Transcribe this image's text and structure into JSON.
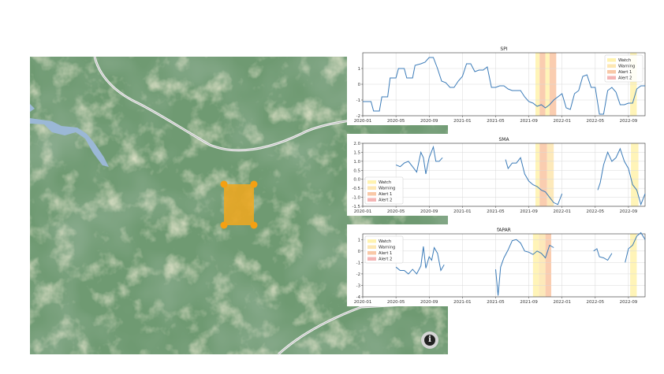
{
  "map": {
    "selection_color": "#f2a81d",
    "handle_color": "#f5a012",
    "info_icon": "info-icon"
  },
  "legend_labels": [
    "Watch",
    "Warning",
    "Alert 1",
    "Alert 2"
  ],
  "legend_colors": [
    "#fff3b0",
    "#fde7b3",
    "#f9c8a7",
    "#f4b5b5"
  ],
  "line_color": "#3b7bb8",
  "chart_data": [
    {
      "type": "line",
      "title": "SPI",
      "legend_position": "top-right",
      "x_ticks": [
        "2020-01",
        "2020-05",
        "2020-09",
        "2021-01",
        "2021-05",
        "2021-09",
        "2022-01",
        "2022-05",
        "2022-09"
      ],
      "x_range": [
        0,
        34
      ],
      "ylim": [
        -2,
        2
      ],
      "y_ticks": [
        "-2",
        "-1",
        "0",
        "1"
      ],
      "bands": [
        {
          "type": "Watch",
          "x": [
            20.8,
            21.3
          ]
        },
        {
          "type": "Alert 1",
          "x": [
            21.3,
            22.0
          ]
        },
        {
          "type": "Watch",
          "x": [
            22.0,
            22.5
          ]
        },
        {
          "type": "Alert 1",
          "x": [
            22.5,
            23.3
          ]
        },
        {
          "type": "Watch",
          "x": [
            32.2,
            33.0
          ]
        }
      ],
      "series": [
        {
          "segments": [
            [
              [
                0,
                -1.1
              ],
              [
                1,
                -1.1
              ],
              [
                1.3,
                -1.7
              ],
              [
                2,
                -1.7
              ],
              [
                2.3,
                -0.8
              ],
              [
                3,
                -0.8
              ],
              [
                3.3,
                0.4
              ],
              [
                4,
                0.4
              ],
              [
                4.3,
                1.0
              ],
              [
                5,
                1.0
              ],
              [
                5.3,
                0.4
              ],
              [
                6,
                0.4
              ],
              [
                6.3,
                1.2
              ],
              [
                7,
                1.3
              ],
              [
                7.5,
                1.4
              ],
              [
                8,
                1.7
              ],
              [
                8.5,
                1.7
              ],
              [
                9,
                1.0
              ],
              [
                9.5,
                0.2
              ],
              [
                10,
                0.1
              ],
              [
                10.5,
                -0.2
              ],
              [
                11,
                -0.2
              ],
              [
                11.5,
                0.2
              ],
              [
                12,
                0.5
              ],
              [
                12.5,
                1.3
              ],
              [
                13,
                1.3
              ],
              [
                13.5,
                0.8
              ],
              [
                14,
                0.9
              ],
              [
                14.5,
                0.9
              ],
              [
                15,
                1.1
              ],
              [
                15.5,
                -0.2
              ],
              [
                16,
                -0.2
              ],
              [
                16.5,
                -0.1
              ],
              [
                17,
                -0.1
              ],
              [
                17.5,
                -0.3
              ],
              [
                18,
                -0.4
              ],
              [
                19,
                -0.4
              ],
              [
                19.5,
                -0.8
              ],
              [
                20,
                -1.1
              ],
              [
                20.5,
                -1.2
              ],
              [
                21,
                -1.4
              ],
              [
                21.5,
                -1.3
              ],
              [
                22,
                -1.5
              ],
              [
                22.5,
                -1.3
              ],
              [
                23,
                -1.0
              ],
              [
                24,
                -0.6
              ],
              [
                24.5,
                -1.5
              ],
              [
                25,
                -1.6
              ],
              [
                25.5,
                -0.6
              ],
              [
                26,
                -0.4
              ],
              [
                26.5,
                0.5
              ],
              [
                27,
                0.6
              ],
              [
                27.5,
                -0.2
              ],
              [
                28,
                -0.2
              ],
              [
                28.5,
                -1.9
              ],
              [
                29,
                -1.9
              ],
              [
                29.5,
                -0.4
              ],
              [
                30,
                -0.2
              ],
              [
                30.5,
                -0.5
              ],
              [
                31,
                -1.3
              ],
              [
                31.5,
                -1.3
              ],
              [
                32,
                -1.2
              ],
              [
                32.5,
                -1.2
              ],
              [
                33,
                -0.3
              ],
              [
                33.5,
                -0.1
              ],
              [
                34,
                -0.1
              ]
            ]
          ]
        }
      ]
    },
    {
      "type": "line",
      "title": "SMA",
      "legend_position": "bottom-left",
      "x_ticks": [
        "2020-01",
        "2020-05",
        "2020-09",
        "2021-01",
        "2021-05",
        "2021-09",
        "2022-01",
        "2022-05",
        "2022-09"
      ],
      "x_range": [
        0,
        34
      ],
      "ylim": [
        -1.5,
        2.0
      ],
      "y_ticks": [
        "-1.5",
        "-1.0",
        "-0.5",
        "0.0",
        "0.5",
        "1.0",
        "1.5",
        "2.0"
      ],
      "bands": [
        {
          "type": "Watch",
          "x": [
            20.8,
            21.3
          ]
        },
        {
          "type": "Alert 1",
          "x": [
            21.3,
            22.2
          ]
        },
        {
          "type": "Warning",
          "x": [
            22.2,
            23.0
          ]
        },
        {
          "type": "Watch",
          "x": [
            32.3,
            33.2
          ]
        }
      ],
      "series": [
        {
          "segments": [
            [
              [
                4,
                0.8
              ],
              [
                4.5,
                0.7
              ],
              [
                5,
                0.9
              ],
              [
                5.5,
                1.0
              ],
              [
                6,
                0.7
              ],
              [
                6.5,
                0.4
              ],
              [
                7,
                1.5
              ],
              [
                7.3,
                1.2
              ],
              [
                7.6,
                0.3
              ],
              [
                8,
                1.2
              ],
              [
                8.5,
                1.8
              ],
              [
                8.8,
                1.0
              ],
              [
                9.2,
                1.0
              ],
              [
                9.6,
                1.2
              ]
            ],
            [
              [
                17.2,
                1.1
              ],
              [
                17.5,
                0.6
              ],
              [
                18,
                0.9
              ],
              [
                18.5,
                0.9
              ],
              [
                19,
                1.2
              ],
              [
                19.5,
                0.3
              ],
              [
                20,
                -0.1
              ],
              [
                20.5,
                -0.3
              ],
              [
                21,
                -0.4
              ],
              [
                21.5,
                -0.6
              ],
              [
                22,
                -0.7
              ],
              [
                22.5,
                -1.0
              ],
              [
                23,
                -1.3
              ],
              [
                23.5,
                -1.4
              ],
              [
                24,
                -0.8
              ]
            ],
            [
              [
                28.3,
                -0.6
              ],
              [
                28.6,
                -0.2
              ],
              [
                29,
                0.8
              ],
              [
                29.5,
                1.5
              ],
              [
                30,
                1.0
              ],
              [
                30.5,
                1.2
              ],
              [
                31,
                1.7
              ],
              [
                31.5,
                1.0
              ],
              [
                32,
                0.6
              ],
              [
                32.5,
                -0.3
              ],
              [
                33,
                -0.6
              ],
              [
                33.5,
                -1.4
              ],
              [
                34,
                -0.8
              ]
            ]
          ]
        }
      ]
    },
    {
      "type": "line",
      "title": "fAPAR",
      "legend_position": "top-left",
      "x_ticks": [
        "2020-01",
        "2020-05",
        "2020-09",
        "2021-01",
        "2021-05",
        "2021-09",
        "2022-01",
        "2022-05",
        "2022-09"
      ],
      "x_range": [
        0,
        34
      ],
      "ylim": [
        -4,
        1.5
      ],
      "y_ticks": [
        "-4",
        "-3",
        "-2",
        "-1",
        "0",
        "1"
      ],
      "bands": [
        {
          "type": "Watch",
          "x": [
            20.5,
            21.2
          ]
        },
        {
          "type": "Warning",
          "x": [
            21.2,
            22.0
          ]
        },
        {
          "type": "Alert 1",
          "x": [
            22.0,
            22.7
          ]
        },
        {
          "type": "Watch",
          "x": [
            32.2,
            33.0
          ]
        }
      ],
      "series": [
        {
          "segments": [
            [
              [
                4,
                -1.4
              ],
              [
                4.5,
                -1.7
              ],
              [
                5,
                -1.7
              ],
              [
                5.5,
                -2.0
              ],
              [
                6,
                -1.6
              ],
              [
                6.5,
                -2.0
              ],
              [
                7,
                -1.3
              ],
              [
                7.3,
                0.4
              ],
              [
                7.6,
                -1.5
              ],
              [
                8,
                -0.5
              ],
              [
                8.3,
                -0.8
              ],
              [
                8.6,
                0.3
              ],
              [
                9,
                -0.2
              ],
              [
                9.4,
                -1.7
              ],
              [
                9.8,
                -1.2
              ]
            ],
            [
              [
                16,
                -1.6
              ],
              [
                16.3,
                -3.9
              ],
              [
                16.6,
                -1.4
              ],
              [
                17,
                -0.6
              ],
              [
                17.5,
                0.1
              ],
              [
                18,
                0.9
              ],
              [
                18.5,
                1.0
              ],
              [
                19,
                0.7
              ],
              [
                19.5,
                0.0
              ],
              [
                20,
                -0.1
              ],
              [
                20.5,
                -0.3
              ],
              [
                21,
                0.0
              ],
              [
                21.5,
                -0.2
              ],
              [
                22,
                -0.6
              ],
              [
                22.5,
                0.5
              ],
              [
                23,
                0.3
              ]
            ],
            [
              [
                27.8,
                0.0
              ],
              [
                28.2,
                0.2
              ],
              [
                28.5,
                -0.5
              ],
              [
                29,
                -0.6
              ],
              [
                29.5,
                -0.8
              ],
              [
                30,
                -0.2
              ]
            ],
            [
              [
                31.6,
                -1.0
              ],
              [
                32,
                0.2
              ],
              [
                32.5,
                0.5
              ],
              [
                33,
                1.3
              ],
              [
                33.5,
                1.6
              ],
              [
                34,
                1.0
              ]
            ]
          ]
        }
      ]
    }
  ]
}
